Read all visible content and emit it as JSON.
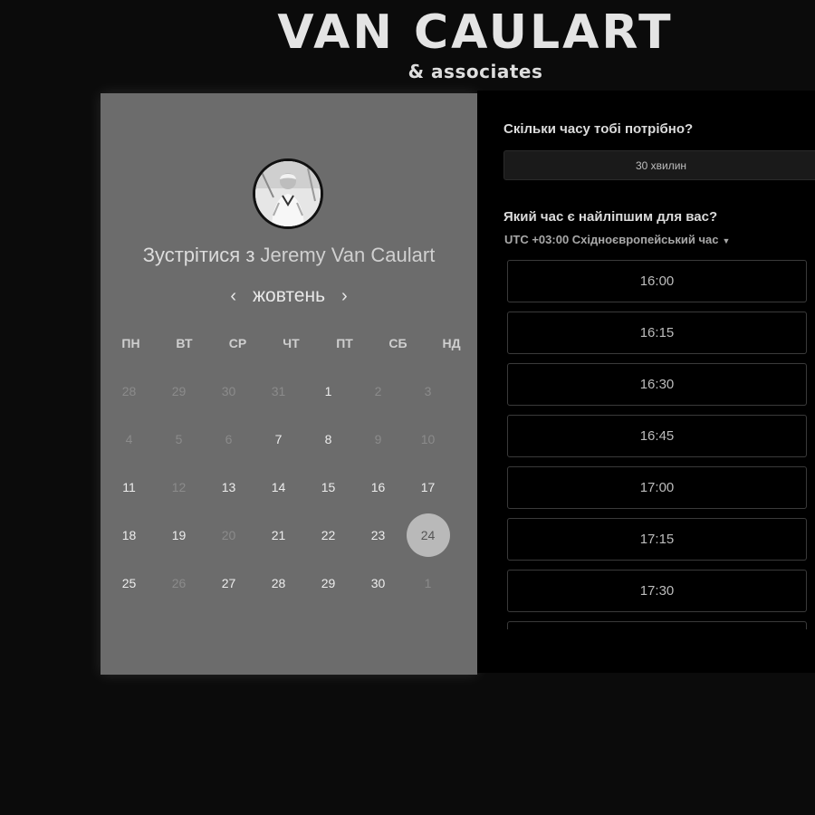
{
  "brand": {
    "title": "VAN CAULART",
    "subtitle": "& associates"
  },
  "calendar": {
    "title_prefix": "Зустрітися з",
    "host_name": "Jeremy Van Caulart",
    "month": "жовтень",
    "prev_icon": "chevron-left-icon",
    "next_icon": "chevron-right-icon",
    "weekdays": [
      "ПН",
      "ВТ",
      "СР",
      "ЧТ",
      "ПТ",
      "СБ",
      "НД"
    ],
    "days": [
      {
        "n": "28",
        "state": "muted"
      },
      {
        "n": "29",
        "state": "muted"
      },
      {
        "n": "30",
        "state": "muted"
      },
      {
        "n": "31",
        "state": "muted"
      },
      {
        "n": "1",
        "state": "available"
      },
      {
        "n": "2",
        "state": "muted"
      },
      {
        "n": "3",
        "state": "muted"
      },
      {
        "n": "4",
        "state": "muted"
      },
      {
        "n": "5",
        "state": "muted"
      },
      {
        "n": "6",
        "state": "muted"
      },
      {
        "n": "7",
        "state": "available"
      },
      {
        "n": "8",
        "state": "available"
      },
      {
        "n": "9",
        "state": "muted"
      },
      {
        "n": "10",
        "state": "muted"
      },
      {
        "n": "11",
        "state": "available"
      },
      {
        "n": "12",
        "state": "muted"
      },
      {
        "n": "13",
        "state": "available"
      },
      {
        "n": "14",
        "state": "available"
      },
      {
        "n": "15",
        "state": "available"
      },
      {
        "n": "16",
        "state": "available"
      },
      {
        "n": "17",
        "state": "available"
      },
      {
        "n": "18",
        "state": "available"
      },
      {
        "n": "19",
        "state": "available"
      },
      {
        "n": "20",
        "state": "muted"
      },
      {
        "n": "21",
        "state": "available"
      },
      {
        "n": "22",
        "state": "available"
      },
      {
        "n": "23",
        "state": "available"
      },
      {
        "n": "24",
        "state": "selected"
      },
      {
        "n": "25",
        "state": "available"
      },
      {
        "n": "26",
        "state": "muted"
      },
      {
        "n": "27",
        "state": "available"
      },
      {
        "n": "28",
        "state": "available"
      },
      {
        "n": "29",
        "state": "available"
      },
      {
        "n": "30",
        "state": "available"
      },
      {
        "n": "1",
        "state": "muted"
      }
    ]
  },
  "booking": {
    "duration_question": "Скільки часу тобі потрібно?",
    "duration_value": "30 хвилин",
    "time_question": "Який час є найліпшим для вас?",
    "timezone": "UTC +03:00 Східноєвропейський час",
    "timezone_icon": "caret-down-icon",
    "slots": [
      "16:00",
      "16:15",
      "16:30",
      "16:45",
      "17:00",
      "17:15",
      "17:30",
      ""
    ]
  }
}
